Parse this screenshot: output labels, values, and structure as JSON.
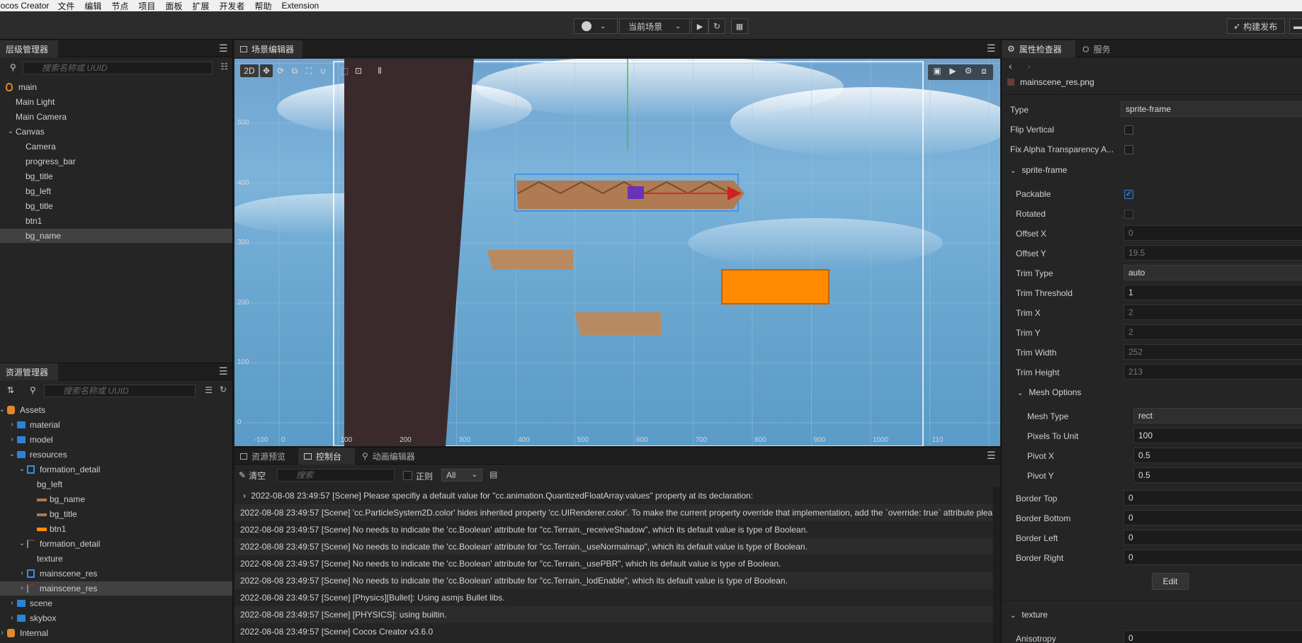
{
  "menubar": {
    "items": [
      "Cocos Creator",
      "文件",
      "编辑",
      "节点",
      "项目",
      "面板",
      "扩展",
      "开发者",
      "帮助",
      "Extension"
    ]
  },
  "toolbar": {
    "scene_select": "当前场景",
    "build_button": "构建发布"
  },
  "hierarchy": {
    "tab": "层级管理器",
    "search_placeholder": "搜索名称或 UUID",
    "nodes": [
      {
        "label": "main",
        "depth": 0,
        "caret": "",
        "icon": "scene-icon"
      },
      {
        "label": "Main Light",
        "depth": 1,
        "caret": ""
      },
      {
        "label": "Main Camera",
        "depth": 1,
        "caret": ""
      },
      {
        "label": "Canvas",
        "depth": 1,
        "caret": "v"
      },
      {
        "label": "Camera",
        "depth": 2,
        "caret": ""
      },
      {
        "label": "progress_bar",
        "depth": 2,
        "caret": ""
      },
      {
        "label": "bg_title",
        "depth": 2,
        "caret": ""
      },
      {
        "label": "bg_left",
        "depth": 2,
        "caret": ""
      },
      {
        "label": "bg_title",
        "depth": 2,
        "caret": ""
      },
      {
        "label": "btn1",
        "depth": 2,
        "caret": ""
      },
      {
        "label": "bg_name",
        "depth": 2,
        "caret": "",
        "selected": true
      }
    ]
  },
  "assets": {
    "tab": "资源管理器",
    "search_placeholder": "搜索名称或 UUID",
    "nodes": [
      {
        "label": "Assets",
        "depth": 0,
        "caret": "v",
        "icon": "db-icon"
      },
      {
        "label": "material",
        "depth": 1,
        "caret": ">",
        "icon": "folder-icon"
      },
      {
        "label": "model",
        "depth": 1,
        "caret": ">",
        "icon": "folder-icon"
      },
      {
        "label": "resources",
        "depth": 1,
        "caret": "v",
        "icon": "folder-icon"
      },
      {
        "label": "formation_detail",
        "depth": 2,
        "caret": "v",
        "icon": "atlas-icon"
      },
      {
        "label": "bg_left",
        "depth": 3,
        "caret": "",
        "icon": "none"
      },
      {
        "label": "bg_name",
        "depth": 3,
        "caret": "",
        "icon": "sprite-brown-icon"
      },
      {
        "label": "bg_title",
        "depth": 3,
        "caret": "",
        "icon": "sprite-brown-icon"
      },
      {
        "label": "btn1",
        "depth": 3,
        "caret": "",
        "icon": "sprite-orange-icon"
      },
      {
        "label": "formation_detail",
        "depth": 2,
        "caret": "v",
        "icon": "image-icon"
      },
      {
        "label": "texture",
        "depth": 3,
        "caret": "",
        "icon": "none"
      },
      {
        "label": "mainscene_res",
        "depth": 2,
        "caret": ">",
        "icon": "atlas-icon"
      },
      {
        "label": "mainscene_res",
        "depth": 2,
        "caret": ">",
        "icon": "image-icon",
        "selected": true
      },
      {
        "label": "scene",
        "depth": 1,
        "caret": ">",
        "icon": "folder-icon"
      },
      {
        "label": "skybox",
        "depth": 1,
        "caret": ">",
        "icon": "folder-icon"
      },
      {
        "label": "Internal",
        "depth": 0,
        "caret": ">",
        "icon": "db-icon"
      }
    ]
  },
  "scene": {
    "tab": "场景编辑器",
    "mode_2d": "2D",
    "y_ticks": [
      "500",
      "400",
      "300",
      "200",
      "100",
      "0"
    ],
    "x_ticks": [
      "-100",
      "0",
      "100",
      "200",
      "300",
      "400",
      "500",
      "600",
      "700",
      "800",
      "900",
      "1000",
      "110"
    ]
  },
  "bottom": {
    "tabs": [
      "资源预览",
      "控制台",
      "动画编辑器"
    ],
    "clear_button": "清空",
    "search_placeholder": "搜索",
    "regex_label": "正则",
    "level_select": "All",
    "logs": [
      "2022-08-08 23:49:57 [Scene] Please specifiy a default value for \"cc.animation.QuantizedFloatArray.values\" property at its declaration:",
      "2022-08-08 23:49:57 [Scene] 'cc.ParticleSystem2D.color' hides inherited property 'cc.UIRenderer.color'. To make the current property override that implementation, add the `override: true` attribute plea",
      "2022-08-08 23:49:57 [Scene] No needs to indicate the 'cc.Boolean' attribute for \"cc.Terrain._receiveShadow\", which its default value is type of Boolean.",
      "2022-08-08 23:49:57 [Scene] No needs to indicate the 'cc.Boolean' attribute for \"cc.Terrain._useNormalmap\", which its default value is type of Boolean.",
      "2022-08-08 23:49:57 [Scene] No needs to indicate the 'cc.Boolean' attribute for \"cc.Terrain._usePBR\", which its default value is type of Boolean.",
      "2022-08-08 23:49:57 [Scene] No needs to indicate the 'cc.Boolean' attribute for \"cc.Terrain._lodEnable\", which its default value is type of Boolean.",
      "2022-08-08 23:49:57 [Scene] [Physics][Bullet]: Using asmjs Bullet libs.",
      "2022-08-08 23:49:57 [Scene] [PHYSICS]: using builtin.",
      "2022-08-08 23:49:57 [Scene] Cocos Creator v3.6.0"
    ]
  },
  "inspector": {
    "tabs": [
      "属性检查器",
      "服务"
    ],
    "asset_name": "mainscene_res.png",
    "type_label": "Type",
    "type_value": "sprite-frame",
    "flip_vertical_label": "Flip Vertical",
    "fix_alpha_label": "Fix Alpha Transparency A...",
    "sprite_frame_section": "sprite-frame",
    "packable_label": "Packable",
    "rotated_label": "Rotated",
    "offset_x_label": "Offset X",
    "offset_x_value": "0",
    "offset_y_label": "Offset Y",
    "offset_y_value": "19.5",
    "trim_type_label": "Trim Type",
    "trim_type_value": "auto",
    "trim_threshold_label": "Trim Threshold",
    "trim_threshold_value": "1",
    "trim_x_label": "Trim X",
    "trim_x_value": "2",
    "trim_y_label": "Trim Y",
    "trim_y_value": "2",
    "trim_width_label": "Trim Width",
    "trim_width_value": "252",
    "trim_height_label": "Trim Height",
    "trim_height_value": "213",
    "mesh_options_section": "Mesh Options",
    "mesh_type_label": "Mesh Type",
    "mesh_type_value": "rect",
    "pixels_to_unit_label": "Pixels To Unit",
    "pixels_to_unit_value": "100",
    "pivot_x_label": "Pivot X",
    "pivot_x_value": "0.5",
    "pivot_y_label": "Pivot Y",
    "pivot_y_value": "0.5",
    "border_top_label": "Border Top",
    "border_top_value": "0",
    "border_bottom_label": "Border Bottom",
    "border_bottom_value": "0",
    "border_left_label": "Border Left",
    "border_left_value": "0",
    "border_right_label": "Border Right",
    "border_right_value": "0",
    "edit_button": "Edit",
    "texture_section": "texture",
    "anisotropy_label": "Anisotropy",
    "anisotropy_value": "0"
  }
}
